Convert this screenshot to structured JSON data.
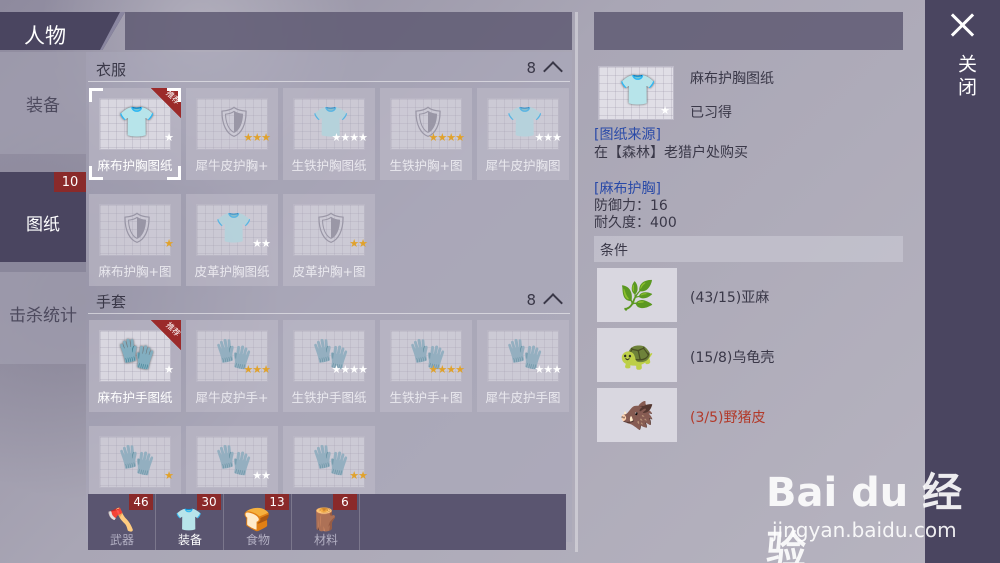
{
  "title": "人物",
  "nav": {
    "items": [
      {
        "label": "装备",
        "active": false
      },
      {
        "label": "图纸",
        "active": true,
        "badge": "10"
      },
      {
        "label": "击杀统计",
        "active": false
      }
    ]
  },
  "sections": [
    {
      "title": "衣服",
      "count": "8",
      "cards": [
        {
          "label": "麻布护胸图纸",
          "icon": "vest-icon",
          "gold": 0,
          "gray": 1,
          "selected": true,
          "ribbon": "推荐"
        },
        {
          "label": "犀牛皮护胸+",
          "icon": "armor-icon",
          "gold": 3,
          "gray": 0
        },
        {
          "label": "生铁护胸图纸",
          "icon": "vest-icon",
          "gold": 0,
          "gray": 4
        },
        {
          "label": "生铁护胸+图",
          "icon": "armor-icon",
          "gold": 4,
          "gray": 0
        },
        {
          "label": "犀牛皮护胸图",
          "icon": "vest-icon",
          "gold": 0,
          "gray": 3
        },
        {
          "label": "麻布护胸+图",
          "icon": "armor-icon",
          "gold": 1,
          "gray": 0
        },
        {
          "label": "皮革护胸图纸",
          "icon": "vest-icon",
          "gold": 0,
          "gray": 2
        },
        {
          "label": "皮革护胸+图",
          "icon": "armor-icon",
          "gold": 2,
          "gray": 0
        }
      ]
    },
    {
      "title": "手套",
      "count": "8",
      "cards": [
        {
          "label": "麻布护手图纸",
          "icon": "glove-icon",
          "gold": 0,
          "gray": 1,
          "ribbon": "推荐"
        },
        {
          "label": "犀牛皮护手+",
          "icon": "glove-icon",
          "gold": 3,
          "gray": 0
        },
        {
          "label": "生铁护手图纸",
          "icon": "glove-icon",
          "gold": 0,
          "gray": 4
        },
        {
          "label": "生铁护手+图",
          "icon": "glove-icon",
          "gold": 4,
          "gray": 0
        },
        {
          "label": "犀牛皮护手图",
          "icon": "glove-icon",
          "gold": 0,
          "gray": 3
        },
        {
          "label": "",
          "icon": "glove-icon",
          "gold": 1,
          "gray": 0
        },
        {
          "label": "",
          "icon": "glove-icon",
          "gold": 0,
          "gray": 2
        },
        {
          "label": "",
          "icon": "glove-icon",
          "gold": 2,
          "gray": 0
        }
      ]
    }
  ],
  "bottom_tabs": [
    {
      "label": "武器",
      "badge": "46",
      "icon": "axe-icon",
      "active": false
    },
    {
      "label": "装备",
      "badge": "30",
      "icon": "shirt-icon",
      "active": true
    },
    {
      "label": "食物",
      "badge": "13",
      "icon": "bread-icon",
      "active": false
    },
    {
      "label": "材料",
      "badge": "6",
      "icon": "wood-icon",
      "active": false
    }
  ],
  "detail": {
    "name": "麻布护胸图纸",
    "status": "已习得",
    "source_heading": "[图纸来源]",
    "source_text": "在【森林】老猎户处购买",
    "item_heading": "[麻布护胸]",
    "defense": "防御力：16",
    "durability": "耐久度：400",
    "conditions_title": "条件",
    "conditions": [
      {
        "text": "(43/15)亚麻",
        "icon": "flax-icon",
        "lacking": false
      },
      {
        "text": "(15/8)乌龟壳",
        "icon": "turtle-shell-icon",
        "lacking": false
      },
      {
        "text": "(3/5)野猪皮",
        "icon": "boar-hide-icon",
        "lacking": true
      }
    ]
  },
  "close_label": "关闭",
  "watermark": {
    "logo": "Bai du 经验",
    "url": "jingyan.baidu.com"
  },
  "colors": {
    "panel_dark": "#4a4560",
    "badge_red": "#8a2a2a",
    "star_gold": "#e0a22c",
    "link_blue": "#2a4aa8",
    "lacking_red": "#b23a2a"
  }
}
